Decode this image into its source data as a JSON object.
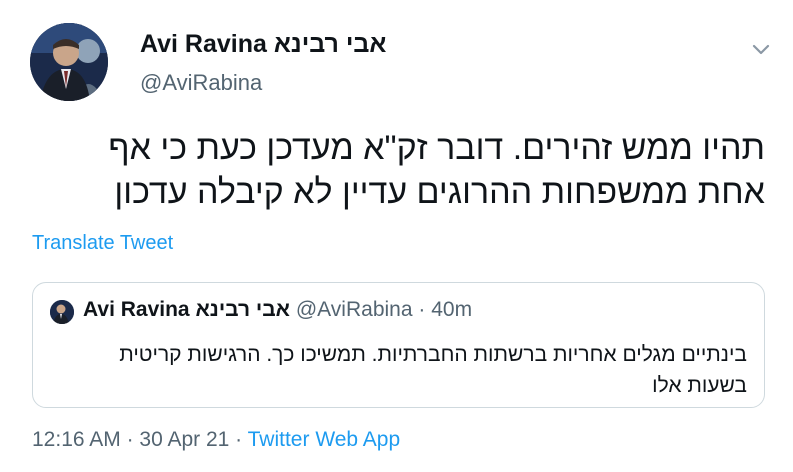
{
  "author": {
    "name": "Avi Ravina אבי רבינא",
    "handle": "@AviRabina"
  },
  "tweet": {
    "text_line1": "תהיו ממש זהירים. דובר זק\"א מעדכן כעת כי אף",
    "text_line2": "אחת ממשפחות ההרוגים עדיין לא קיבלה עדכון",
    "translate_label": "Translate Tweet"
  },
  "quoted": {
    "name": "Avi Ravina אבי רבינא",
    "handle": "@AviRabina",
    "separator": "·",
    "time": "40m",
    "text_line1": "בינתיים מגלים אחריות ברשתות החברתיות. תמשיכו כך. הרגישות קריטית",
    "text_line2": "בשעות אלו"
  },
  "footer": {
    "time": "12:16 AM",
    "sep1": "·",
    "date": "30 Apr 21",
    "sep2": "·",
    "app": "Twitter Web App"
  },
  "icons": {
    "menu": "chevron-down-icon"
  },
  "colors": {
    "link": "#1d9bf0",
    "secondary": "#536471",
    "text": "#0f1419",
    "border": "#cfd9de"
  }
}
